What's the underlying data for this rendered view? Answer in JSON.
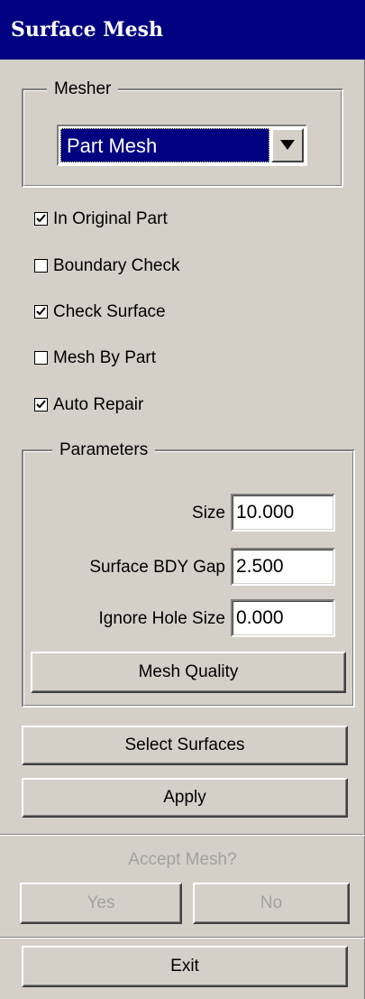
{
  "window": {
    "title": "Surface Mesh"
  },
  "mesher": {
    "legend": "Mesher",
    "selected": "Part Mesh",
    "arrow_icon": "triangle-down"
  },
  "options": [
    {
      "label": "In Original Part",
      "checked": true
    },
    {
      "label": "Boundary Check",
      "checked": false
    },
    {
      "label": "Check Surface",
      "checked": true
    },
    {
      "label": "Mesh By Part",
      "checked": false
    },
    {
      "label": "Auto Repair",
      "checked": true
    }
  ],
  "parameters": {
    "legend": "Parameters",
    "size": {
      "label": "Size",
      "value": "10.000"
    },
    "bdy_gap": {
      "label": "Surface BDY Gap",
      "value": "2.500"
    },
    "hole_size": {
      "label": "Ignore Hole Size",
      "value": "0.000"
    },
    "mesh_quality_label": "Mesh Quality"
  },
  "actions": {
    "select_surfaces_label": "Select Surfaces",
    "apply_label": "Apply"
  },
  "accept": {
    "prompt": "Accept Mesh?",
    "yes_label": "Yes",
    "no_label": "No"
  },
  "exit_label": "Exit",
  "colors": {
    "face": "#d4d0c8",
    "titlebar": "#000080",
    "selection": "#000080",
    "disabled_text": "#a0a0a0"
  }
}
